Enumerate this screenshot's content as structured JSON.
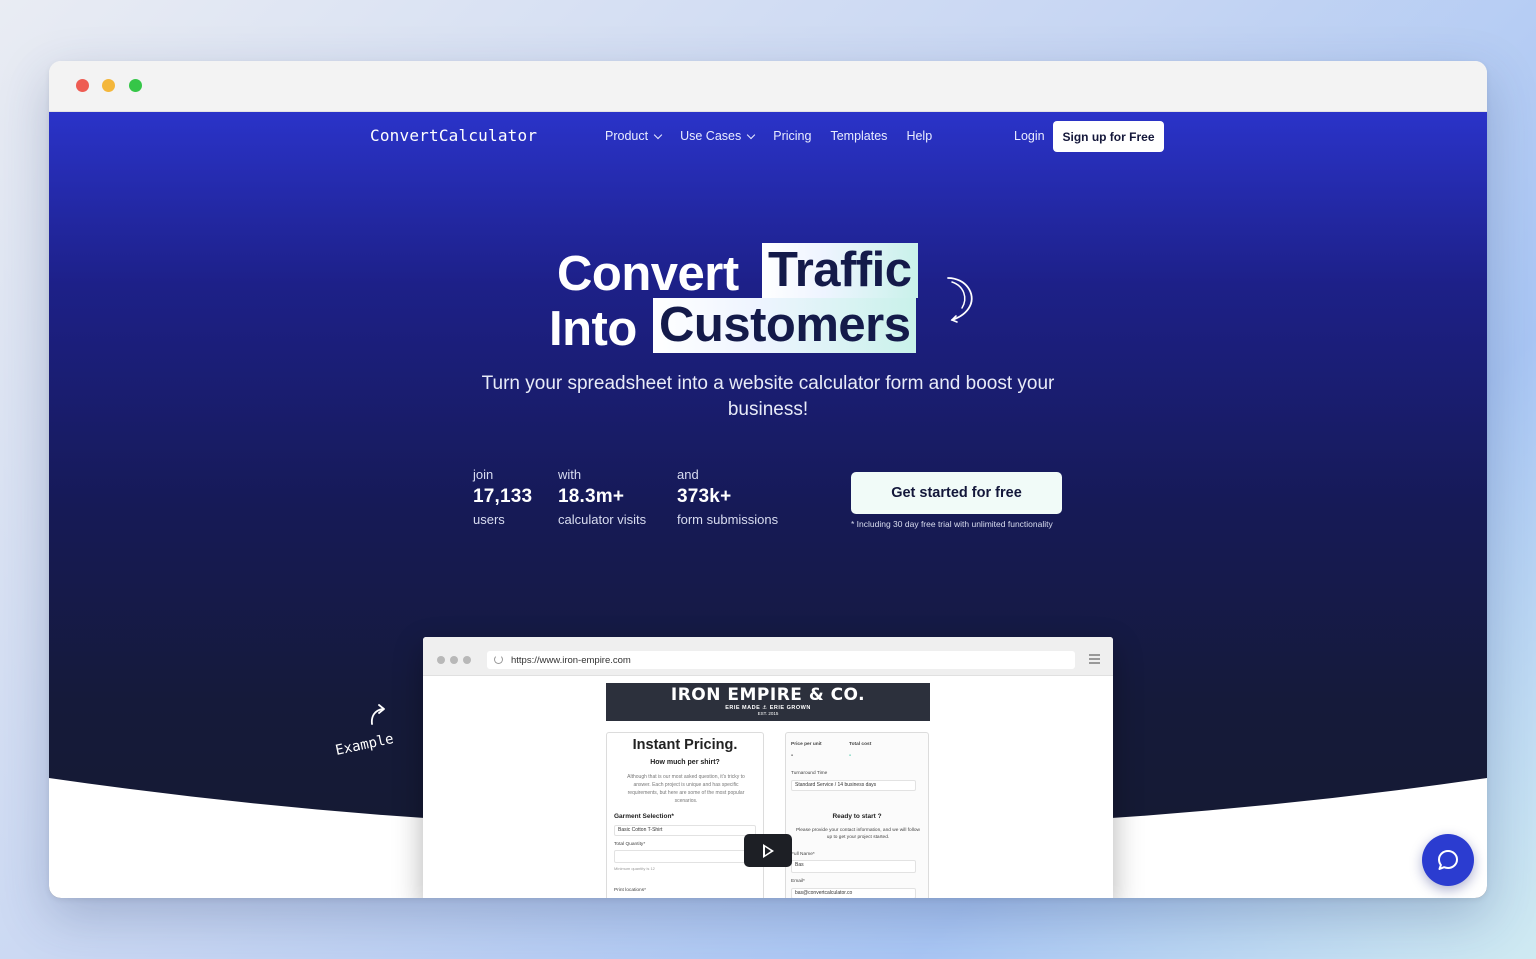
{
  "window": {
    "controls": [
      "close",
      "minimize",
      "maximize"
    ]
  },
  "nav": {
    "logo": "ConvertCalculator",
    "items": [
      {
        "label": "Product",
        "has_dropdown": true
      },
      {
        "label": "Use Cases",
        "has_dropdown": true
      },
      {
        "label": "Pricing",
        "has_dropdown": false
      },
      {
        "label": "Templates",
        "has_dropdown": false
      },
      {
        "label": "Help",
        "has_dropdown": false
      }
    ],
    "login": "Login",
    "signup": "Sign up for Free"
  },
  "hero": {
    "line1_plain": "Convert",
    "line1_highlight": "Traffic",
    "line2_plain": "Into",
    "line2_highlight": "Customers",
    "subtitle": "Turn your spreadsheet into a website calculator form and boost your business!"
  },
  "stats": [
    {
      "pre": "join",
      "value": "17,133",
      "post": "users"
    },
    {
      "pre": "with",
      "value": "18.3m+",
      "post": "calculator visits"
    },
    {
      "pre": "and",
      "value": "373k+",
      "post": "form submissions"
    }
  ],
  "cta": {
    "label": "Get started for free",
    "note": "* Including 30 day free trial with unlimited functionality"
  },
  "example_label": "Example",
  "demo": {
    "url": "https://www.iron-empire.com",
    "brand": "IRON EMPIRE & CO.",
    "brand_tagline": "ERIE MADE ⚓ ERIE GROWN",
    "brand_est": "EST. 2015",
    "title": "Instant Pricing.",
    "subtitle": "How much per shirt?",
    "intro": "Although that is our most asked question, it's tricky to answer. Each project is unique and has specific requirements, but here are some of the most popular scenarios.",
    "garment_label": "Garment Selection*",
    "garment_value": "Basic Cotton T-Shirt",
    "quantity_label": "Total Quantity*",
    "quantity_note": "Minimum quantity is 12",
    "print_label": "Print locations*",
    "price_per_unit_label": "Price per unit",
    "price_per_unit_value": "-",
    "total_cost_label": "Total cost",
    "total_cost_value": "-",
    "turnaround_label": "Turnaround Time",
    "turnaround_value": "Standard Service / 14 business days",
    "ready_title": "Ready to start ?",
    "ready_text": "Please provide your contact information, and we will follow up to get your project started.",
    "fullname_label": "Full Name*",
    "fullname_value": "Bas",
    "email_label": "Email*",
    "email_value": "bas@convertcalculator.co"
  },
  "colors": {
    "hero_top": "#2a33c9",
    "hero_bottom": "#151a30",
    "chat_button": "#2b3cd0"
  }
}
